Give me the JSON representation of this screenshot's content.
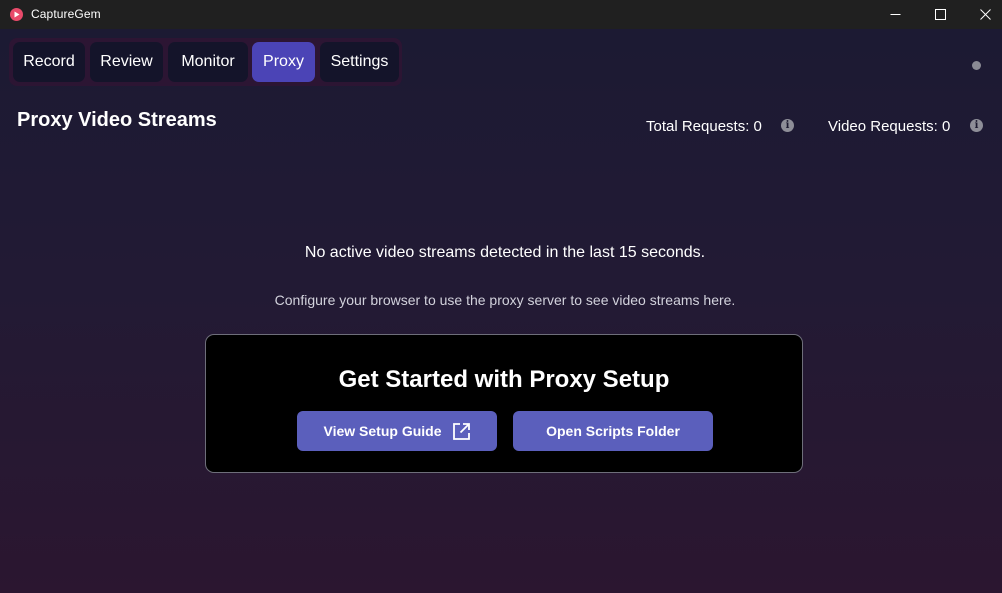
{
  "window": {
    "title": "CaptureGem",
    "app_icon": "record-play-icon",
    "controls": [
      "minimize-icon",
      "maximize-icon",
      "close-icon"
    ]
  },
  "tabs": [
    {
      "label": "Record",
      "active": false
    },
    {
      "label": "Review",
      "active": false
    },
    {
      "label": "Monitor",
      "active": false
    },
    {
      "label": "Proxy",
      "active": true
    },
    {
      "label": "Settings",
      "active": false
    }
  ],
  "header": {
    "title": "Proxy Video Streams",
    "stats": {
      "total_requests": "Total Requests: 0",
      "video_requests": "Video Requests: 0"
    }
  },
  "empty_state": {
    "message": "No active video streams detected in the last 15 seconds.",
    "hint": "Configure your browser to use the proxy server to see video streams here."
  },
  "setup_card": {
    "title": "Get Started with Proxy Setup",
    "guide_button": "View Setup Guide",
    "scripts_button": "Open Scripts Folder"
  },
  "colors": {
    "active_tab": "#4b44b6",
    "button": "#5b5fbc",
    "background_top": "#1c1a33",
    "background_bottom": "#2b1630"
  }
}
